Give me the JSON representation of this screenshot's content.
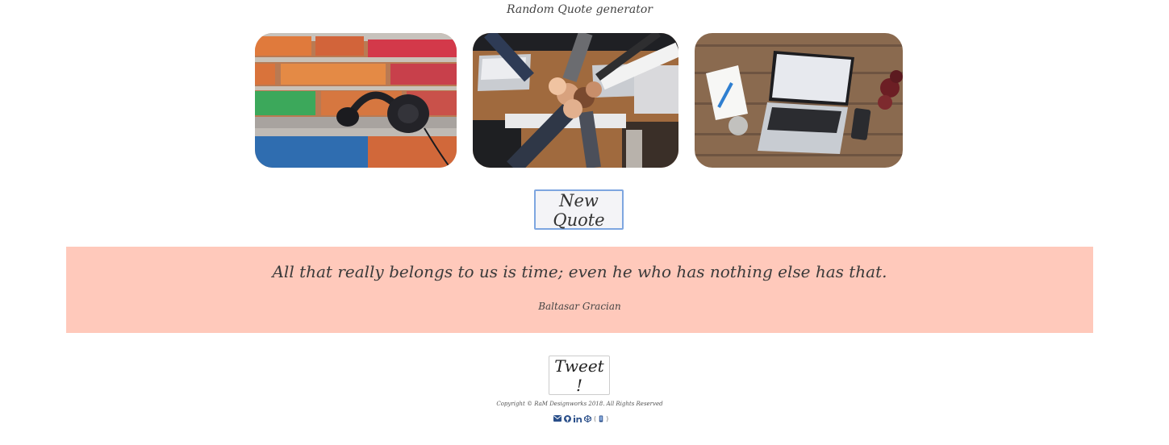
{
  "header": {
    "title": "Random Quote generator"
  },
  "gallery": {
    "images": [
      {
        "icon": "headphones-on-brick-wall-photo"
      },
      {
        "icon": "team-fist-bump-over-laptops-photo"
      },
      {
        "icon": "laptop-on-wooden-desk-photo"
      }
    ]
  },
  "actions": {
    "new_quote_label": "New Quote",
    "tweet_label": "Tweet !"
  },
  "quote": {
    "text": "All that really belongs to us is time; even he who has nothing else has that.",
    "author": "Baltasar Gracian",
    "background": "#ffc9bb"
  },
  "footer": {
    "copyright": "Copyright © RaM Designworks 2018. All Rights Reserved",
    "social_icons": [
      "envelope-icon",
      "github-icon",
      "linkedin-icon",
      "codepen-icon",
      "mobile-icon"
    ]
  },
  "colors": {
    "accent": "#7ea6e0",
    "icon": "#2a4f8a"
  }
}
